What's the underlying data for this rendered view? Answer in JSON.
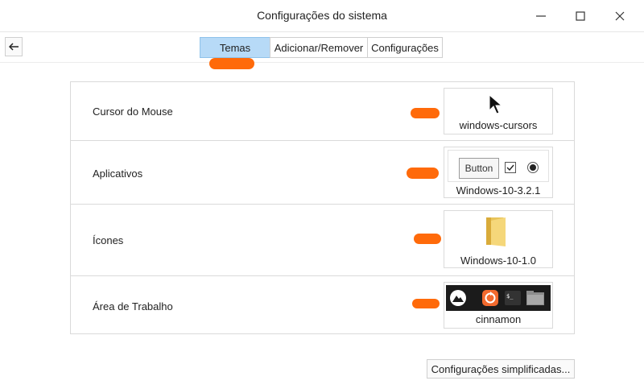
{
  "window": {
    "title": "Configurações do sistema"
  },
  "toolbar": {
    "tabs": [
      {
        "label": "Temas",
        "active": true
      },
      {
        "label": "Adicionar/Remover",
        "active": false
      },
      {
        "label": "Configurações",
        "active": false
      }
    ]
  },
  "themes": {
    "rows": [
      {
        "label": "Cursor do Mouse",
        "value": "windows-cursors",
        "preview_icon": "cursor-arrow-icon"
      },
      {
        "label": "Aplicativos",
        "value": "Windows-10-3.2.1",
        "preview_icon": "widgets-preview",
        "button_text": "Button"
      },
      {
        "label": "Ícones",
        "value": "Windows-10-1.0",
        "preview_icon": "folder-icon"
      },
      {
        "label": "Área de Trabalho",
        "value": "cinnamon",
        "preview_icon": "panel-preview"
      }
    ]
  },
  "footer": {
    "simplified_button": "Configurações simplificadas..."
  },
  "colors": {
    "active_tab": "#b7daf7",
    "redaction": "#ff6a0a"
  }
}
